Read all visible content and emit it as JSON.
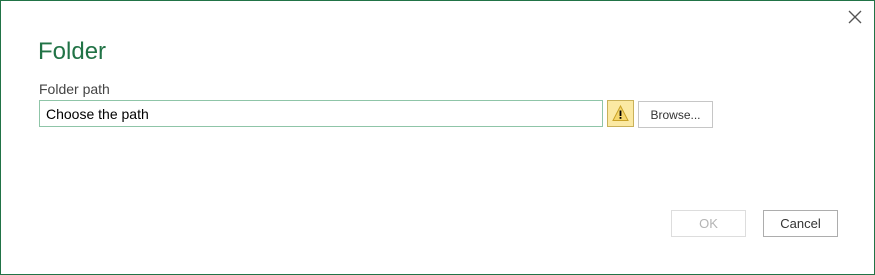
{
  "dialog": {
    "title": "Folder",
    "close_icon": "close-icon",
    "accent_color": "#217346"
  },
  "folder_path": {
    "label": "Folder path",
    "value": "Choose the path",
    "status_icon": "warning-icon",
    "status_color": "#fbe9a3"
  },
  "buttons": {
    "browse_label": "Browse...",
    "ok_label": "OK",
    "ok_enabled": false,
    "cancel_label": "Cancel"
  }
}
